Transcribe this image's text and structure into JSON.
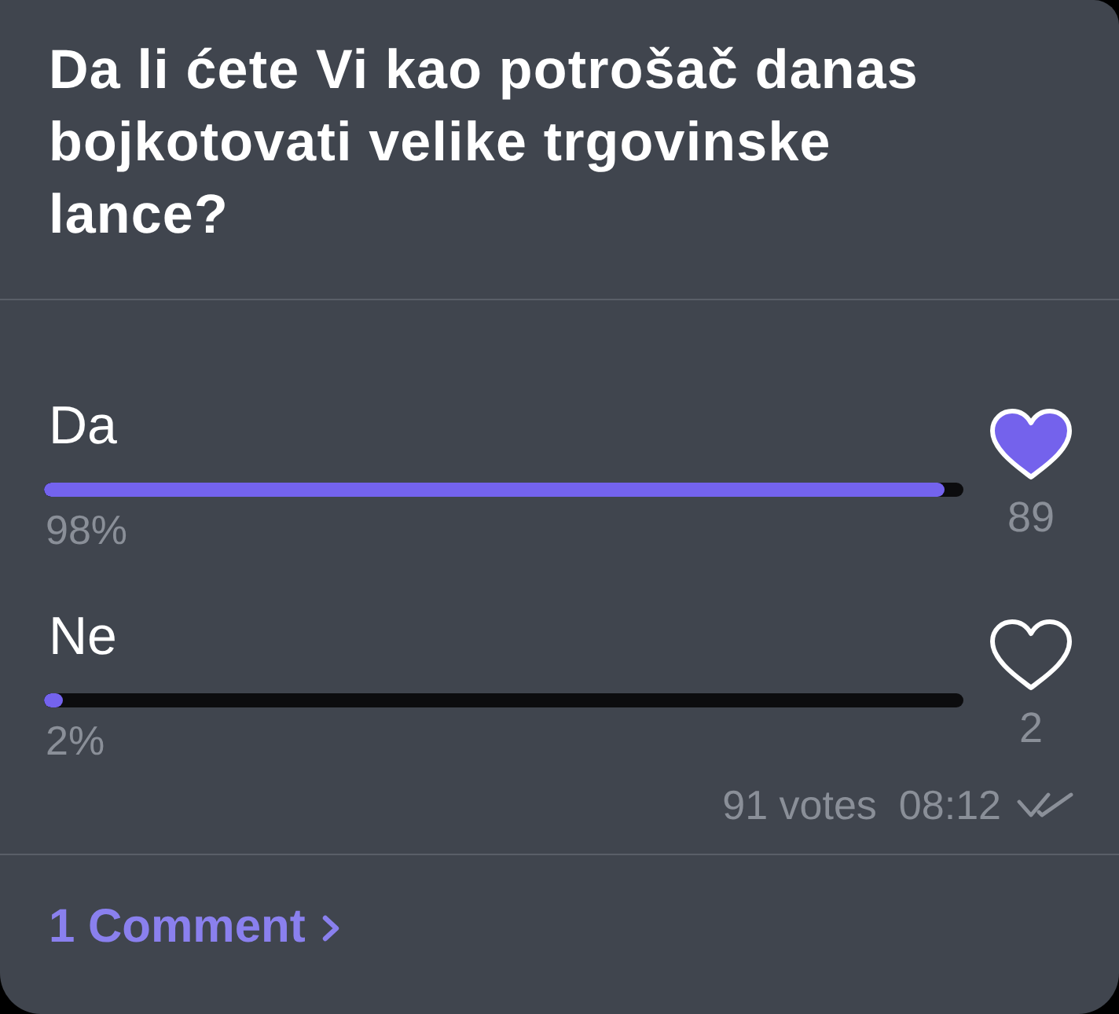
{
  "question": "Da li ćete Vi kao potrošač danas bojkotovati velike trgovinske lance?",
  "options": [
    {
      "label": "Da",
      "level": 0.98,
      "percent": "98%",
      "count": "89",
      "selected": true
    },
    {
      "label": "Ne",
      "level": 0.02,
      "percent": "2%",
      "count": "2",
      "selected": false
    }
  ],
  "footer": {
    "votes": "91 votes",
    "time": "08:12",
    "read": true
  },
  "comments": {
    "label": "1 Comment"
  }
}
